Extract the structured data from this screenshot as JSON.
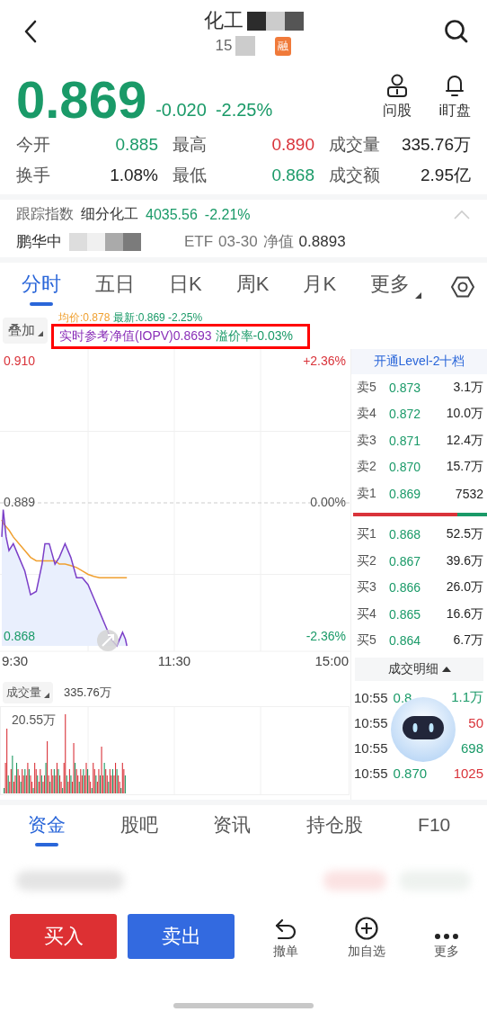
{
  "header": {
    "title": "化工",
    "code": "15",
    "badge": "融"
  },
  "quote": {
    "price": "0.869",
    "change": "-0.020",
    "change_pct": "-2.25%",
    "color": "#1a9a68",
    "actions": [
      {
        "label": "问股",
        "kind": "person"
      },
      {
        "label": "i盯盘",
        "kind": "bell"
      }
    ]
  },
  "stats": [
    {
      "label": "今开",
      "value": "0.885",
      "color": "#1a9a68"
    },
    {
      "label": "最高",
      "value": "0.890",
      "color": "#d9333a"
    },
    {
      "label": "成交量",
      "value": "335.76万",
      "color": "#222222"
    },
    {
      "label": "换手",
      "value": "1.08%",
      "color": "#222222"
    },
    {
      "label": "最低",
      "value": "0.868",
      "color": "#1a9a68"
    },
    {
      "label": "成交额",
      "value": "2.95亿",
      "color": "#222222"
    }
  ],
  "tracking": {
    "label": "跟踪指数",
    "index": "细分化工",
    "value": "4035.56",
    "change": "-2.21%",
    "expanded": true
  },
  "fund": {
    "name_start": "鹏华中",
    "name_end": "ETF",
    "date": "03-30",
    "nav_label": "净值",
    "nav": "0.8893"
  },
  "chart_tabs": [
    {
      "label": "分时",
      "selected": true,
      "kind": "tab"
    },
    {
      "label": "五日",
      "selected": false,
      "kind": "tab"
    },
    {
      "label": "日K",
      "selected": false,
      "kind": "tab"
    },
    {
      "label": "周K",
      "selected": false,
      "kind": "tab"
    },
    {
      "label": "月K",
      "selected": false,
      "kind": "tab"
    },
    {
      "label": "更多",
      "selected": false,
      "kind": "menu"
    }
  ],
  "overlay_button": "叠加",
  "legend": {
    "avg": "均价:0.878",
    "latest": "最新:0.869 -2.25%"
  },
  "iopv": {
    "label": "实时参考净值(IOPV)0.8693",
    "premium": "溢价率-0.03%"
  },
  "intraday": {
    "right_labels": [
      {
        "label": "+2.36%",
        "color": "#d9333a"
      },
      {
        "label": "0.00%",
        "color": "#555555"
      },
      {
        "label": "-2.36%",
        "color": "#1a9a68"
      }
    ],
    "price_labels": [
      {
        "label": "0.910",
        "color": "#d9333a"
      },
      {
        "label": "0.889",
        "color": "#555555"
      },
      {
        "label": "0.868",
        "color": "#1a9a68"
      }
    ],
    "time_labels": [
      "9:30",
      "11:30",
      "15:00"
    ]
  },
  "order_book": {
    "promo": "开通Level-2十档",
    "asks": [
      {
        "label": "卖5",
        "price": "0.873",
        "volume": "3.1万"
      },
      {
        "label": "卖4",
        "price": "0.872",
        "volume": "10.0万"
      },
      {
        "label": "卖3",
        "price": "0.871",
        "volume": "12.4万"
      },
      {
        "label": "卖2",
        "price": "0.870",
        "volume": "15.7万"
      },
      {
        "label": "卖1",
        "price": "0.869",
        "volume": "7532"
      }
    ],
    "level": 0.78,
    "bids": [
      {
        "label": "买1",
        "price": "0.868",
        "volume": "52.5万"
      },
      {
        "label": "买2",
        "price": "0.867",
        "volume": "39.6万"
      },
      {
        "label": "买3",
        "price": "0.866",
        "volume": "26.0万"
      },
      {
        "label": "买4",
        "price": "0.865",
        "volume": "16.6万"
      },
      {
        "label": "买5",
        "price": "0.864",
        "volume": "6.7万"
      }
    ],
    "detail_button": "成交明细"
  },
  "volume": {
    "label": "成交量",
    "total": "335.76万",
    "max": "20.55万"
  },
  "trades": [
    {
      "time": "10:55",
      "price": "0.8",
      "volume": "1.1万",
      "color": "#1a9a68"
    },
    {
      "time": "10:55",
      "volume": "50",
      "color": "#d9333a"
    },
    {
      "time": "10:55",
      "volume": "698",
      "color": "#1a9a68"
    },
    {
      "time": "10:55",
      "price": "0.870",
      "volume": "1025",
      "color": "#d9333a"
    }
  ],
  "bottom_tabs": [
    {
      "label": "资金",
      "selected": true
    },
    {
      "label": "股吧",
      "selected": false
    },
    {
      "label": "资讯",
      "selected": false
    },
    {
      "label": "持仓股",
      "selected": false
    },
    {
      "label": "F10",
      "selected": false
    }
  ],
  "buy": "买入",
  "sell": "卖出",
  "tools": [
    {
      "label": "撤单",
      "kind": "undo"
    },
    {
      "label": "加自选",
      "kind": "add"
    },
    {
      "label": "更多",
      "kind": "more"
    }
  ]
}
